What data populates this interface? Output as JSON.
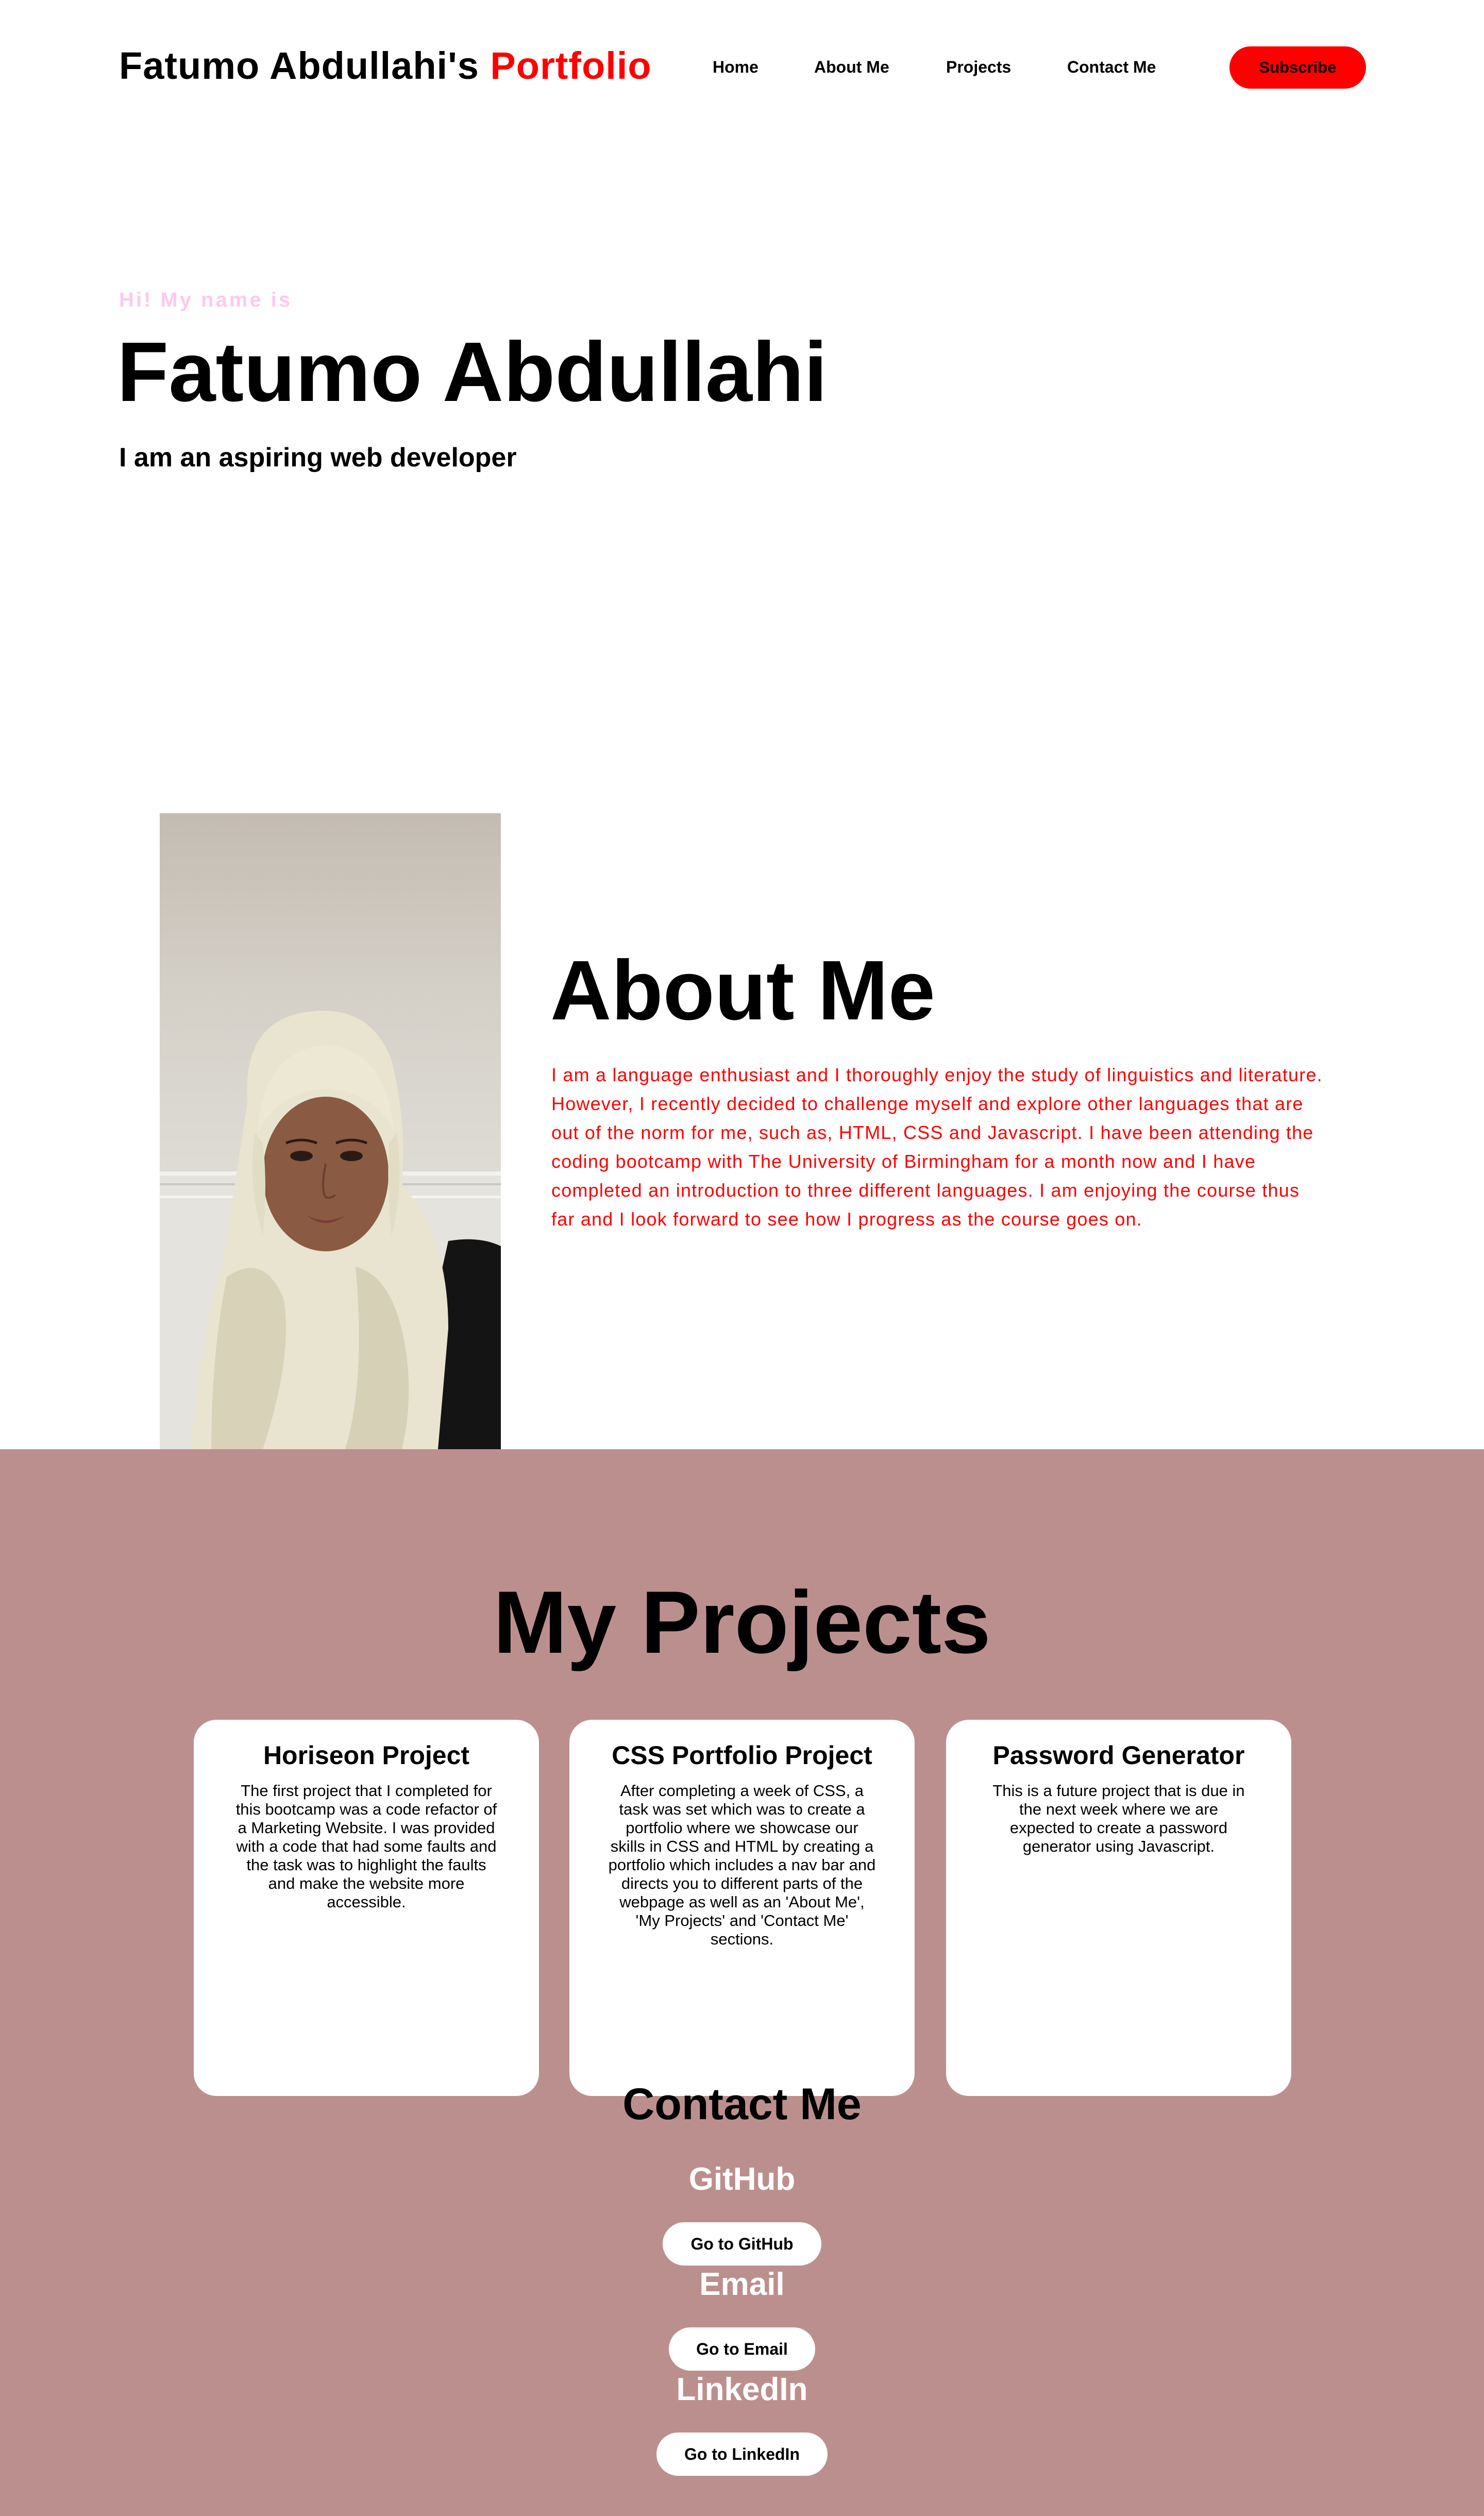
{
  "header": {
    "logo_main": "Fatumo Abdullahi's",
    "logo_accent": "Portfolio",
    "nav": [
      "Home",
      "About Me",
      "Projects",
      "Contact Me"
    ],
    "subscribe_label": "Subscribe"
  },
  "hero": {
    "greeting": "Hi! My name is",
    "name": "Fatumo Abdullahi",
    "tagline": "I am an aspiring web developer"
  },
  "about": {
    "title": "About Me",
    "text": "I am a language enthusiast and I thoroughly enjoy the study of linguistics and literature. However, I recently decided to challenge myself and explore other languages that are out of the norm for me, such as, HTML, CSS and Javascript. I have been attending the coding bootcamp with The University of Birmingham for a month now and I have completed an introduction to three different languages. I am enjoying the course thus far and I look forward to see how I progress as the course goes on."
  },
  "projects": {
    "title": "My Projects",
    "cards": [
      {
        "title": "Horiseon Project",
        "text": "The first project that I completed for this bootcamp was a code refactor of a Marketing Website. I was provided with a code that had some faults and the task was to highlight the faults and make the website more accessible."
      },
      {
        "title": "CSS Portfolio Project",
        "text": "After completing a week of CSS, a task was set which was to create a portfolio where we showcase our skills in CSS and HTML by creating a portfolio which includes a nav bar and directs you to different parts of the webpage as well as an 'About Me', 'My Projects' and 'Contact Me' sections."
      },
      {
        "title": "Password Generator",
        "text": "This is a future project that is due in the next week where we are expected to create a password generator using Javascript."
      }
    ]
  },
  "contact": {
    "title": "Contact Me",
    "items": [
      {
        "label": "GitHub",
        "button": "Go to GitHub"
      },
      {
        "label": "Email",
        "button": "Go to Email"
      },
      {
        "label": "LinkedIn",
        "button": "Go to LinkedIn"
      }
    ]
  },
  "colors": {
    "accent": "#ff0000",
    "greeting": "#ffc8ee",
    "section_background": "#bc8f8f",
    "card_background": "#ffffff"
  }
}
